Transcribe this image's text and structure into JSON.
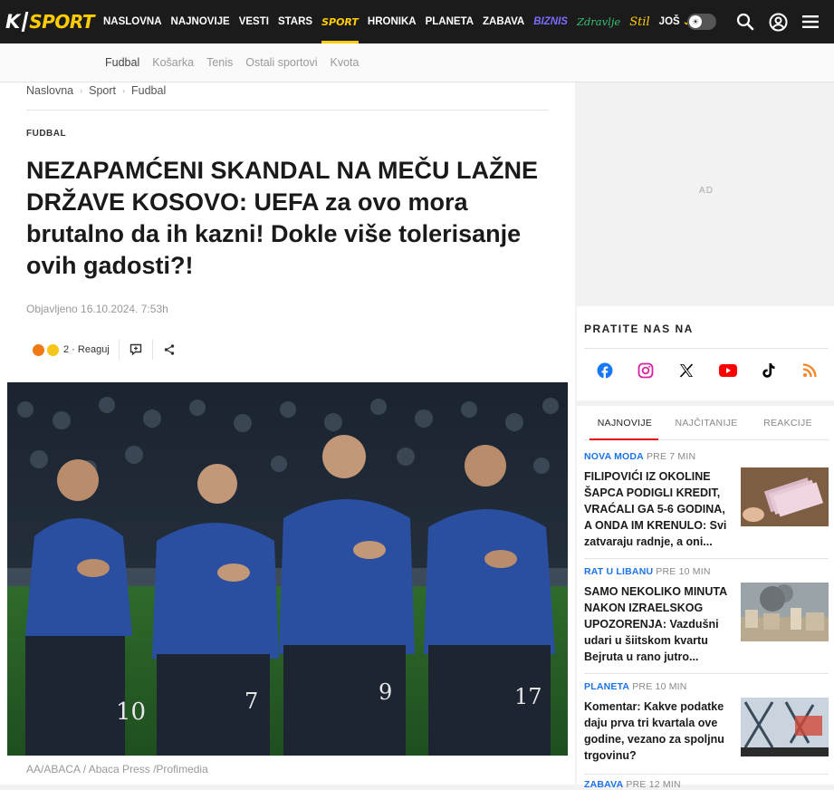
{
  "nav": {
    "logo_k": "K",
    "logo_sport": "SPORT",
    "items": [
      "NASLOVNA",
      "NAJNOVIJE",
      "VESTI",
      "STARS",
      "SPORT",
      "HRONIKA",
      "PLANETA",
      "ZABAVA",
      "BIZNIS",
      "Zdravlje",
      "Stil",
      "JOŠ"
    ],
    "active": "SPORT"
  },
  "subnav": {
    "items": [
      "Fudbal",
      "Košarka",
      "Tenis",
      "Ostali sportovi",
      "Kvota"
    ],
    "active": "Fudbal"
  },
  "breadcrumb": [
    "Naslovna",
    "Sport",
    "Fudbal"
  ],
  "article": {
    "category": "FUDBAL",
    "headline": "NEZAPAMĆENI SKANDAL NA MEČU LAŽNE DRŽAVE KOSOVO: UEFA za ovo mora brutalno da ih kazni! Dokle više tolerisanje ovih gadosti?!",
    "published": "Objavljeno 16.10.2024. 7:53h",
    "reactions_label": "2 · Reaguj",
    "photo_caption": "AA/ABACA / Abaca Press /Profimedia",
    "jersey_numbers": [
      "10",
      "7",
      "9",
      "17"
    ]
  },
  "sidebar": {
    "ad_label": "AD",
    "follow_title": "PRATITE NAS NA",
    "social": [
      "facebook-icon",
      "instagram-icon",
      "x-icon",
      "youtube-icon",
      "tiktok-icon",
      "rss-icon"
    ],
    "tabs": [
      "NAJNOVIJE",
      "NAJČITANIJE",
      "REAKCIJE"
    ],
    "active_tab": "NAJNOVIJE",
    "news": [
      {
        "category": "NOVA MODA",
        "time": "PRE 7 MIN",
        "title": "FILIPOVIĆI IZ OKOLINE ŠAPCA PODIGLI KREDIT, VRAĆALI GA 5-6 GODINA, A ONDA IM KRENULO: Svi zatvaraju radnje, a oni..."
      },
      {
        "category": "RAT U LIBANU",
        "time": "PRE 10 MIN",
        "title": "SAMO NEKOLIKO MINUTA NAKON IZRAELSKOG UPOZORENJA: Vazdušni udari u šiitskom kvartu Bejruta u rano jutro..."
      },
      {
        "category": "PLANETA",
        "time": "PRE 10 MIN",
        "title": "Komentar: Kakve podatke daju prva tri kvartala ove godine, vezano za spoljnu trgovinu?"
      },
      {
        "category": "ZABAVA",
        "time": "PRE 12 MIN",
        "title": ""
      }
    ]
  },
  "colors": {
    "nav_bg": "#1b1b1b",
    "accent_yellow": "#ffcc00",
    "accent_red": "#e30613",
    "link_blue": "#1a73e8",
    "jersey_blue": "#2a4fa0"
  }
}
